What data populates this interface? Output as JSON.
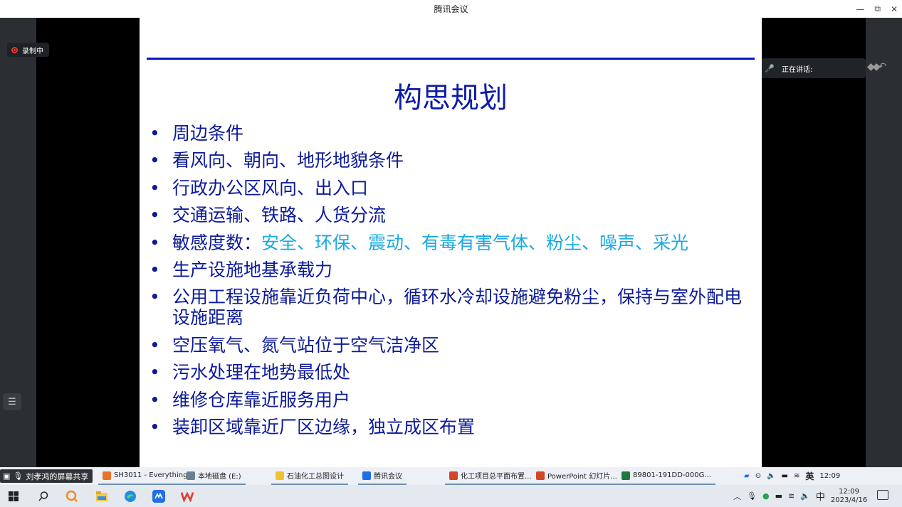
{
  "window": {
    "title": "腾讯会议",
    "controls": [
      "—",
      "⧉",
      "✕"
    ]
  },
  "recording": {
    "label": "录制中"
  },
  "speaker": {
    "label": "正在讲话:"
  },
  "slide": {
    "title": "构思规划",
    "bullets": [
      {
        "text": "周边条件"
      },
      {
        "text": "看风向、朝向、地形地貌条件"
      },
      {
        "text": "行政办公区风向、出入口"
      },
      {
        "text": "交通运输、铁路、人货分流"
      },
      {
        "text": "敏感度数：",
        "highlight": "安全、环保、震动、有毒有害气体、粉尘、噪声、采光"
      },
      {
        "text": "生产设施地基承载力"
      },
      {
        "text": "公用工程设施靠近负荷中心，循环水冷却设施避免粉尘，保持与室外配电设施距离"
      },
      {
        "text": "空压氧气、氮气站位于空气洁净区"
      },
      {
        "text": "污水处理在地势最低处"
      },
      {
        "text": "维修仓库靠近服务用户"
      },
      {
        "text": "装卸区域靠近厂区边缘，独立成区布置"
      }
    ]
  },
  "share": {
    "label": "刘孝鸿的屏幕共享"
  },
  "tasks": [
    {
      "label": "SH3011 - Everything",
      "color": "#e8732c"
    },
    {
      "label": "本地磁盘 (E:)",
      "color": "#6b7f95"
    },
    {
      "label": "石油化工总图设计",
      "color": "#f2c12e"
    },
    {
      "label": "腾讯会议",
      "color": "#1e6fe8"
    },
    {
      "label": "化工项目总平面布置...",
      "color": "#d24726"
    },
    {
      "label": "PowerPoint 幻灯片...",
      "color": "#d24726"
    },
    {
      "label": "89801-191DD-000G...",
      "color": "#1d7a3c"
    }
  ],
  "tray_top": {
    "lang": "英",
    "time": "12:09"
  },
  "tray": {
    "lang": "中",
    "time": "12:09",
    "date": "2023/4/16"
  },
  "taskbar_icons": [
    "windows-icon",
    "search-icon",
    "everything-icon",
    "file-explorer-icon",
    "edge-icon",
    "tencent-meeting-icon",
    "wps-icon"
  ]
}
